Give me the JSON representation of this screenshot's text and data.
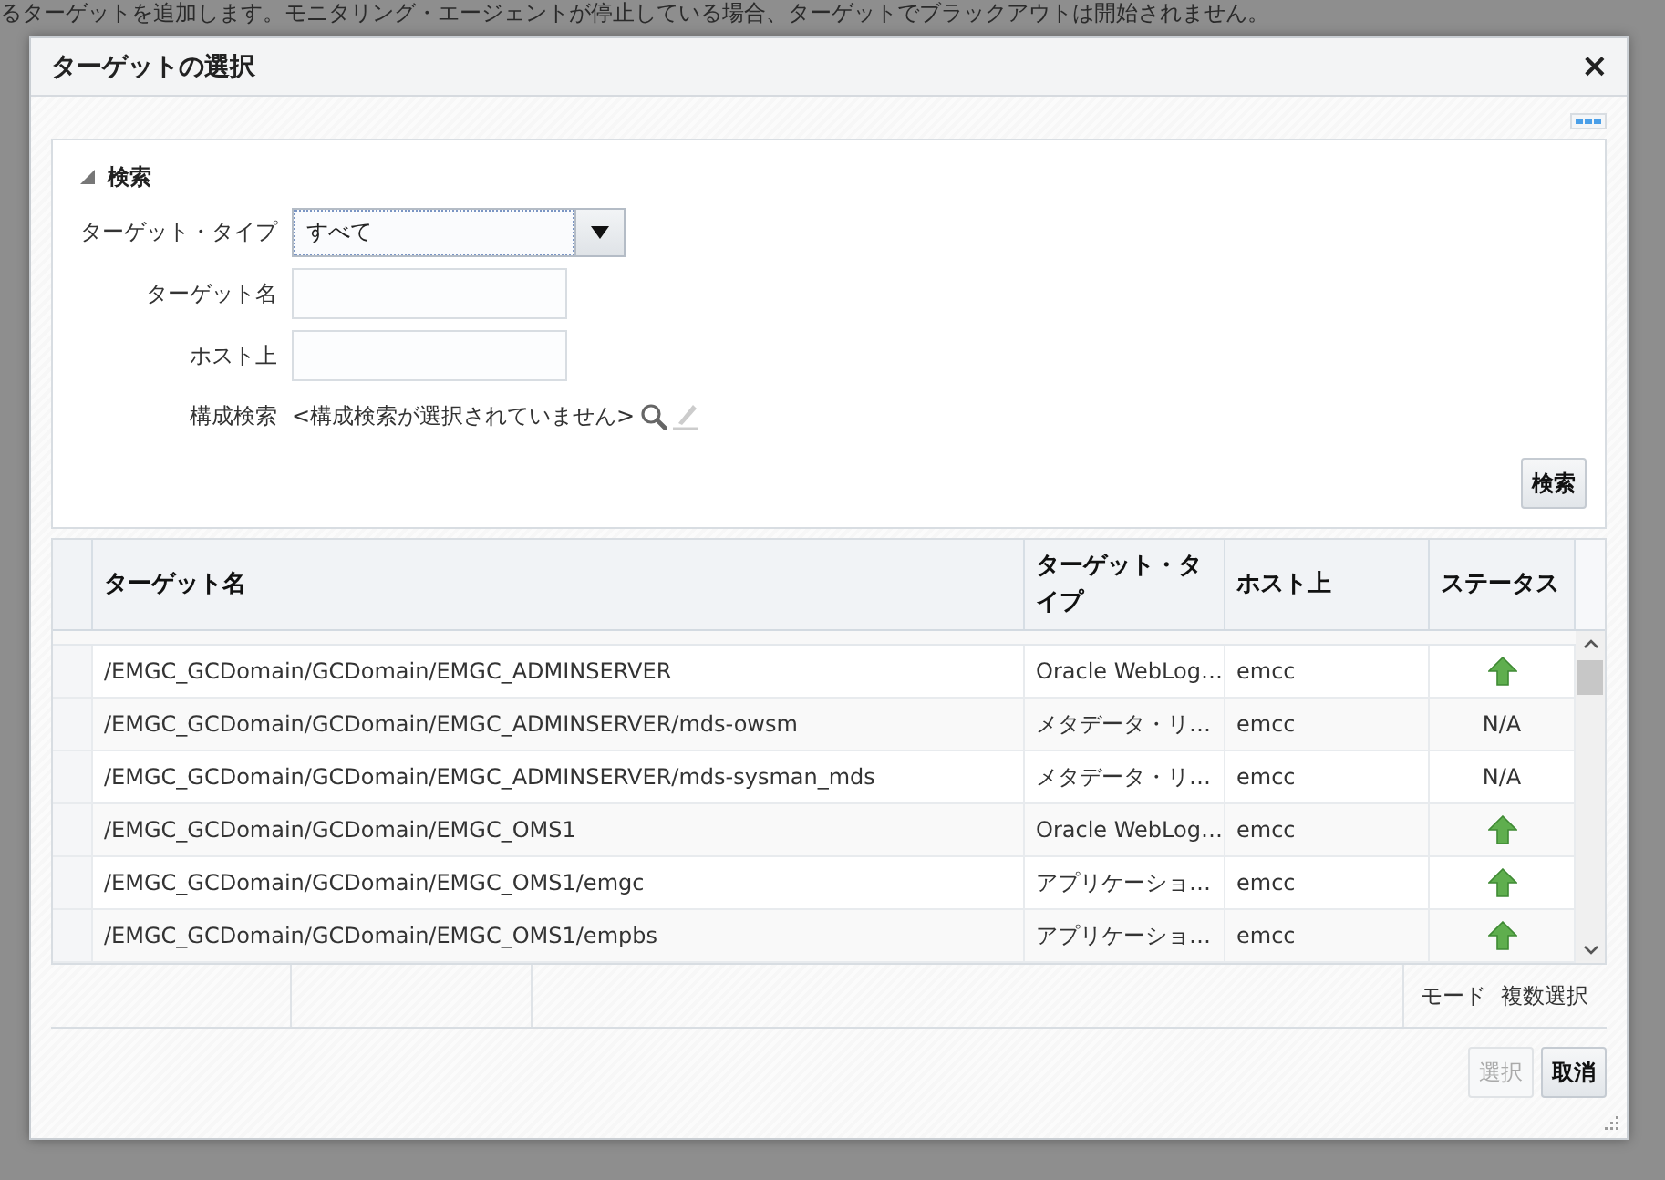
{
  "background_page": {
    "notice": "るターゲットを追加します。モニタリング・エージェントが停止している場合、ターゲットでブラックアウトは開始されません。"
  },
  "dialog": {
    "title": "ターゲットの選択",
    "close": "×"
  },
  "search": {
    "heading": "検索",
    "expanded": true,
    "fields": [
      {
        "kind": "select",
        "label": "ターゲット・タイプ",
        "value": "すべて"
      },
      {
        "kind": "input",
        "label": "ターゲット名"
      },
      {
        "kind": "input",
        "label": "ホスト上"
      },
      {
        "kind": "config",
        "label": "構成検索",
        "value": "<構成検索が選択されていません>"
      }
    ],
    "button": "検索"
  },
  "table": {
    "columns": [
      "ターゲット名",
      "ターゲット・タイプ",
      "ホスト上",
      "ステータス"
    ],
    "rows": [
      {
        "name": "/EMGC_GCDomain/GCDomain/EMGC_ADMINSERVER",
        "type": "Oracle WebLog…",
        "host": "emcc",
        "status": {
          "kind": "up"
        }
      },
      {
        "name": "/EMGC_GCDomain/GCDomain/EMGC_ADMINSERVER/mds-owsm",
        "type": "メタデータ・リ…",
        "host": "emcc",
        "status": {
          "kind": "text",
          "text": "N/A"
        }
      },
      {
        "name": "/EMGC_GCDomain/GCDomain/EMGC_ADMINSERVER/mds-sysman_mds",
        "type": "メタデータ・リ…",
        "host": "emcc",
        "status": {
          "kind": "text",
          "text": "N/A"
        }
      },
      {
        "name": "/EMGC_GCDomain/GCDomain/EMGC_OMS1",
        "type": "Oracle WebLog…",
        "host": "emcc",
        "status": {
          "kind": "up"
        }
      },
      {
        "name": "/EMGC_GCDomain/GCDomain/EMGC_OMS1/emgc",
        "type": "アプリケーショ…",
        "host": "emcc",
        "status": {
          "kind": "up"
        }
      },
      {
        "name": "/EMGC_GCDomain/GCDomain/EMGC_OMS1/empbs",
        "type": "アプリケーショ…",
        "host": "emcc",
        "status": {
          "kind": "up"
        }
      }
    ],
    "mode_label": "モード",
    "mode_value": "複数選択"
  },
  "buttons": [
    {
      "label": "選択",
      "disabled": true
    },
    {
      "label": "取消",
      "disabled": false
    }
  ]
}
